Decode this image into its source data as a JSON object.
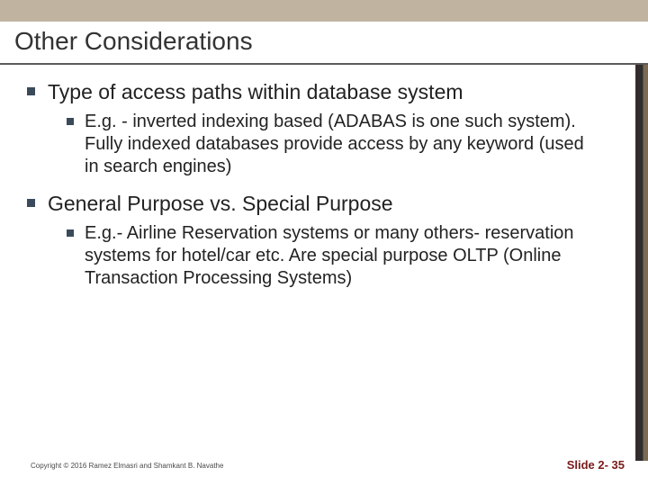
{
  "slide": {
    "title": "Other Considerations",
    "bullets": [
      {
        "text": "Type of access paths within database system",
        "sub": [
          {
            "text": "E.g. - inverted indexing based (ADABAS is one such system). Fully indexed databases provide access by any keyword (used in search engines)"
          }
        ]
      },
      {
        "text": "General Purpose vs. Special Purpose",
        "sub": [
          {
            "text": "E.g.- Airline Reservation systems or many others- reservation systems for hotel/car etc.  Are special purpose OLTP (Online Transaction Processing Systems)"
          }
        ]
      }
    ],
    "footer": {
      "copyright": "Copyright © 2016 Ramez Elmasri and Shamkant B. Navathe",
      "page": "Slide 2- 35"
    }
  }
}
